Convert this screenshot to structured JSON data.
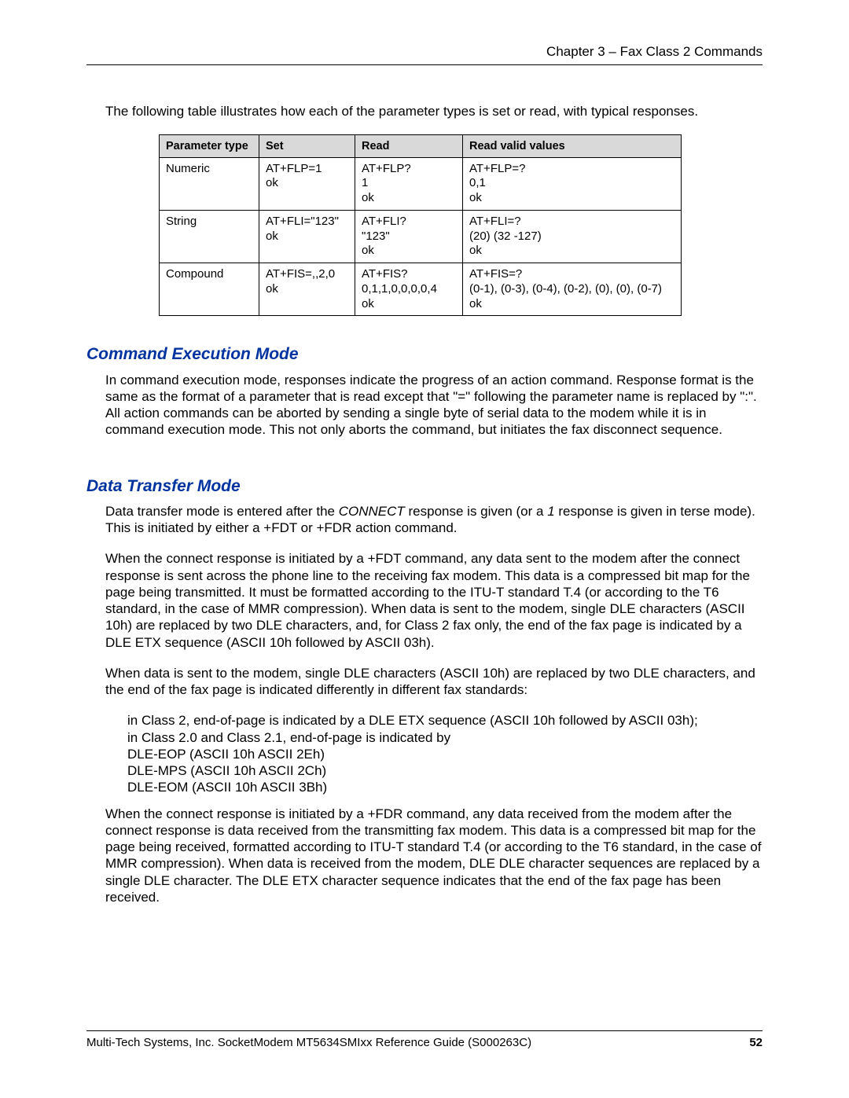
{
  "header": "Chapter 3 – Fax Class 2 Commands",
  "intro": "The following table illustrates how each of the parameter types is set or read, with typical responses.",
  "table": {
    "headers": [
      "Parameter type",
      "Set",
      "Read",
      "Read valid values"
    ],
    "rows": [
      {
        "c0": "Numeric",
        "c1": "AT+FLP=1\nok",
        "c2": "AT+FLP?\n1\nok",
        "c3": "AT+FLP=?\n0,1\nok"
      },
      {
        "c0": "String",
        "c1": "AT+FLI=\"123\"\nok",
        "c2": "AT+FLI?\n\"123\"\nok",
        "c3": "AT+FLI=?\n(20) (32 -127)\nok"
      },
      {
        "c0": "Compound",
        "c1": "AT+FIS=,,2,0\nok",
        "c2": "AT+FIS?\n0,1,1,0,0,0,0,4\nok",
        "c3": "AT+FIS=?\n(0-1), (0-3), (0-4), (0-2), (0), (0), (0-7)\nok"
      }
    ]
  },
  "sec1": {
    "title": "Command Execution Mode",
    "p1": "In command execution mode, responses indicate the progress of an action command. Response format is the same as the format of a parameter that is read except that \"=\" following the parameter name is replaced by \":\". All action commands can be aborted by sending a single byte of serial data to the modem while it is in command execution mode. This not only aborts the command, but initiates the fax disconnect sequence."
  },
  "sec2": {
    "title": "Data Transfer Mode",
    "p1_a": "Data transfer mode is entered after the ",
    "p1_b": "CONNECT",
    "p1_c": " response is given (or a ",
    "p1_d": "1",
    "p1_e": " response is given in terse mode). This is initiated by either a +FDT or +FDR action command.",
    "p2": "When the connect response is initiated by a +FDT command, any data sent to the modem after the connect response is sent across the phone line to the receiving fax modem. This data is a compressed bit map for the page being transmitted. It must be formatted according to the ITU-T standard T.4 (or according to the T6 standard, in the case of MMR compression). When data is sent to the modem, single DLE characters (ASCII 10h) are replaced by two DLE characters, and, for Class 2 fax only, the end of the fax page is indicated by a DLE ETX sequence (ASCII 10h followed by ASCII 03h).",
    "p3": "When data is sent to the modem, single DLE characters (ASCII 10h) are replaced by two DLE characters, and the end of the fax page is indicated differently in different fax standards:",
    "list": "in Class 2, end-of-page is indicated by a DLE ETX sequence (ASCII 10h followed by ASCII 03h);\nin Class 2.0 and Class 2.1, end-of-page is indicated by\nDLE-EOP (ASCII 10h ASCII 2Eh)\nDLE-MPS (ASCII 10h ASCII 2Ch)\nDLE-EOM (ASCII 10h ASCII 3Bh)",
    "p4": "When the connect response is initiated by a +FDR command, any data received from the modem after the connect response is data received from the transmitting fax modem. This data is a compressed bit map for the page being received, formatted according to ITU-T standard T.4 (or according to the T6 standard, in the case of MMR compression). When data is received from the modem, DLE DLE character sequences are replaced by a single DLE character. The DLE ETX character sequence indicates that the end of the fax page has been received."
  },
  "footer": {
    "text": "Multi-Tech Systems, Inc. SocketModem MT5634SMIxx Reference Guide (S000263C)",
    "page": "52"
  }
}
